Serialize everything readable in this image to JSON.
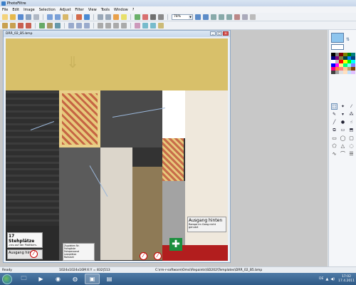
{
  "app": {
    "title": "PhotoFiltre"
  },
  "menu": [
    "File",
    "Edit",
    "Image",
    "Selection",
    "Adjust",
    "Filter",
    "View",
    "Tools",
    "Window",
    "?"
  ],
  "toolbar": {
    "zoom_value": "78%"
  },
  "document": {
    "title": "DRR_02_B5.bmp",
    "buttons": {
      "minimize": "_",
      "maximize": "□",
      "close": "×"
    },
    "texture_texts": {
      "sign_17_big": "17 Stehplätze",
      "sign_17_small": "-neu auf der Plattform-",
      "ausgang_left": "Ausgang hinten",
      "ausgang_right": "Ausgang hinten",
      "ausgang_right_small": "Rampe im Gang nicht genutzt",
      "zug_title": "Zugdaten Nr.",
      "zug_line1": "Fahrgäste",
      "zug_line2": "Fahrpersonal",
      "zug_line3": "Leerplätze",
      "zug_line4": "Rollstuhl"
    }
  },
  "colors": {
    "foreground": "#8ec5ee",
    "background": "#ffffff",
    "accent": "#3b7fc8"
  },
  "palette": [
    "#000000",
    "#808080",
    "#800000",
    "#808000",
    "#008000",
    "#008080",
    "#000080",
    "#800080",
    "#808040",
    "#004040",
    "#0080ff",
    "#004080",
    "#ffffff",
    "#c0c0c0",
    "#ff0000",
    "#ffff00",
    "#00ff00",
    "#00ffff",
    "#0000ff",
    "#ff00ff",
    "#ffff80",
    "#00ff80",
    "#80ffff",
    "#8080ff",
    "#ff0080",
    "#ff8040",
    "#ff8080",
    "#ffcc99",
    "#c0a060",
    "#804000",
    "#404040",
    "#a0a0a0",
    "#e0e0e0",
    "#ffe0c0",
    "#c0e0ff",
    "#e0c0ff"
  ],
  "tools": [
    "select-arrow",
    "magic-wand",
    "color-picker",
    "pencil",
    "fill",
    "spray",
    "brush",
    "blur",
    "smudge",
    "clone",
    "eraser",
    "stamp"
  ],
  "shapes": [
    "rectangle",
    "ellipse",
    "rounded-rect",
    "polygon",
    "triangle",
    "lasso",
    "freeform",
    "bezier",
    "text-tool"
  ],
  "status": {
    "ready": "Ready",
    "dims": "1024x1024x16M",
    "xy": "X:Y = 832|513",
    "path": "C:\\rm-r-software\\Omsi\\Repaints\\SD202\\Templates\\DRR_02_B5.bmp"
  },
  "taskbar": {
    "language": "DE",
    "time": "17:02",
    "date": "17.4.2011"
  }
}
